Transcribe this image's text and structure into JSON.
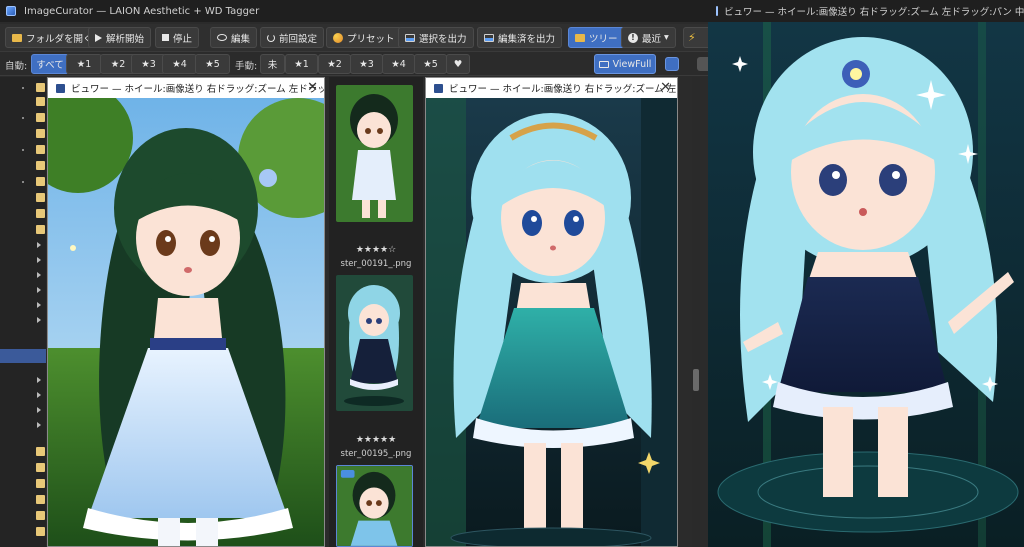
{
  "main": {
    "title": "ImageCurator — LAION Aesthetic + WD Tagger"
  },
  "toolbar": {
    "open_folder": "フォルダを開く",
    "start_analysis": "解析開始",
    "stop": "停止",
    "edit": "編集",
    "prev_settings": "前回設定",
    "preset": "プリセット",
    "export_selection": "選択を出力",
    "export_edited": "編集済を出力",
    "tree": "ツリー",
    "recent": "最近",
    "recent_arrow": "▾"
  },
  "filter": {
    "auto_label": "自動:",
    "auto_chips": [
      "すべて",
      "★1",
      "★2",
      "★3",
      "★4",
      "★5"
    ],
    "manual_label": "手動:",
    "manual_chips": [
      "未",
      "★1",
      "★2",
      "★3",
      "★4",
      "★5",
      "♥"
    ],
    "viewfull": "ViewFull"
  },
  "viewer_left": {
    "title": "ビュワー — ホイール:画像送り 右ドラッグ:ズーム 左ドラッグ:パン 中ボタン:ズー",
    "close": "✕"
  },
  "viewer_mid": {
    "title": "ビュワー — ホイール:画像送り 右ドラッグ:ズーム 左ドラッグ:パン 中ボタン:ズー",
    "close": "✕"
  },
  "thumbnails": [
    {
      "stars": "★★★★☆",
      "file": "ster_00191_.png"
    },
    {
      "stars": "★★★★★",
      "file": "ster_00195_.png"
    }
  ],
  "viewer_right": {
    "title": "ビュワー — ホイール:画像送り 右ドラッグ:ズーム 左ドラッグ:パン 中ボタン:ズー"
  }
}
